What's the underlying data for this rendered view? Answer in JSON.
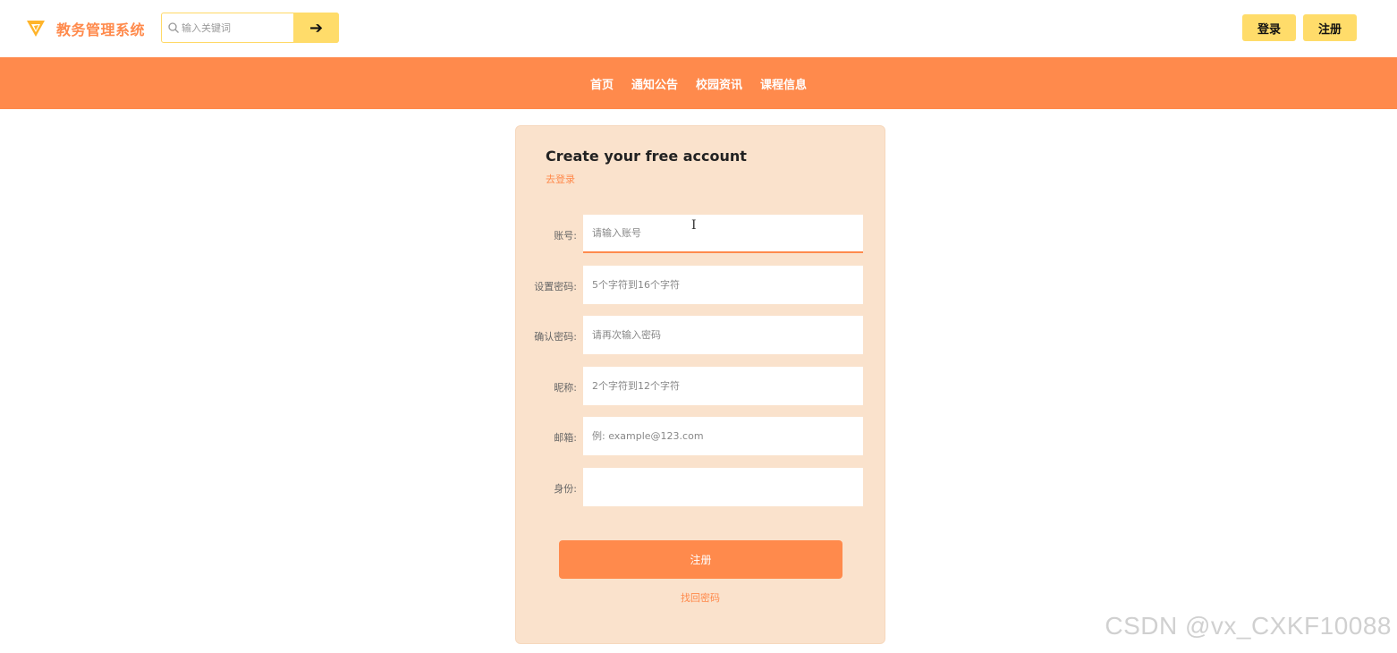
{
  "header": {
    "brand": "教务管理系统",
    "search_placeholder": "输入关键词",
    "search_button_icon": "arrow-right-icon",
    "login_label": "登录",
    "register_label": "注册",
    "accent_color": "#ffdc6a",
    "brand_color": "#ff8a4c"
  },
  "nav": {
    "items": [
      "首页",
      "通知公告",
      "校园资讯",
      "课程信息"
    ],
    "background": "#ff8a4c"
  },
  "form": {
    "title": "Create your free account",
    "login_link": "去登录",
    "fields": [
      {
        "label": "账号:",
        "placeholder": "请输入账号",
        "value": ""
      },
      {
        "label": "设置密码:",
        "placeholder": "5个字符到16个字符",
        "value": ""
      },
      {
        "label": "确认密码:",
        "placeholder": "请再次输入密码",
        "value": ""
      },
      {
        "label": "昵称:",
        "placeholder": "2个字符到12个字符",
        "value": ""
      },
      {
        "label": "邮箱:",
        "placeholder": "例: example@123.com",
        "value": ""
      },
      {
        "label": "身份:",
        "placeholder": "",
        "value": ""
      }
    ],
    "submit_label": "注册",
    "forgot_link": "找回密码",
    "card_color": "#fae2cc"
  },
  "watermark": "CSDN @vx_CXKF10088"
}
